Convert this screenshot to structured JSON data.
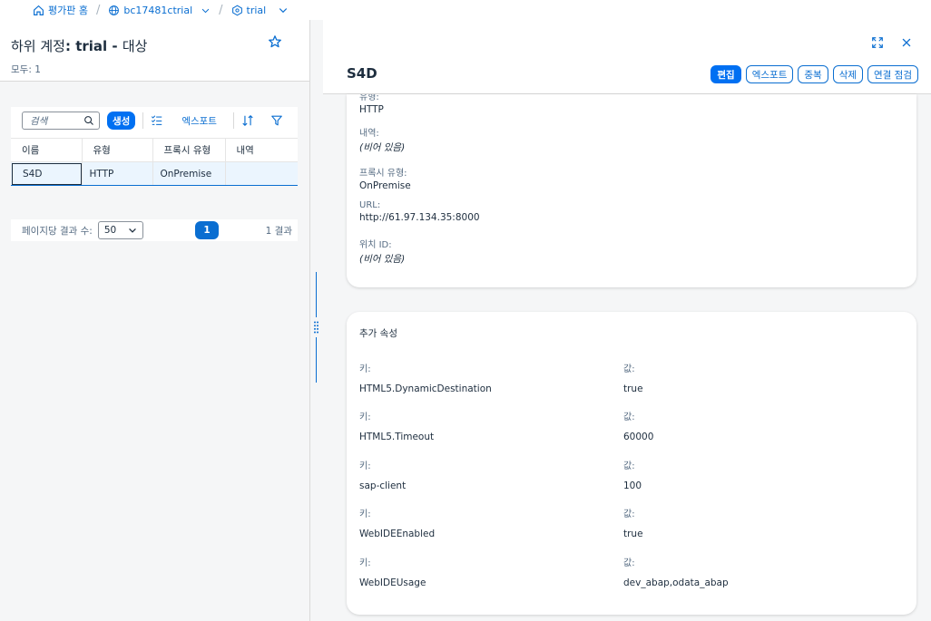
{
  "breadcrumb": {
    "home": "평가판 홈",
    "subaccount": "bc17481ctrial",
    "space": "trial"
  },
  "left": {
    "title_prefix": "하위 계정",
    "title_colon": ":",
    "title_bold": "trial",
    "title_dash": " - ",
    "title_suffix": "대상",
    "subtitle": "모두: 1",
    "search_placeholder": "검색",
    "create_button": "생성",
    "export_button": "엑스포트",
    "columns": [
      "이름",
      "유형",
      "프록시 유형",
      "내역"
    ],
    "rows": [
      {
        "name": "S4D",
        "type": "HTTP",
        "proxy": "OnPremise",
        "desc": ""
      }
    ],
    "per_page_label": "페이지당 결과 수:",
    "per_page_value": "50",
    "current_page": "1",
    "results_count": "1 결과"
  },
  "right": {
    "title": "S4D",
    "actions": {
      "edit": "편집",
      "export": "엑스포트",
      "duplicate": "중복",
      "delete": "삭제",
      "check": "연결 점검"
    },
    "fields": [
      {
        "label": "유형:",
        "value": "HTTP",
        "empty": false
      },
      {
        "label": "내역:",
        "value": "(비어 있음)",
        "empty": true
      },
      {
        "label": "프록시 유형:",
        "value": "OnPremise",
        "empty": false
      },
      {
        "label": "URL:",
        "value": "http://61.97.134.35:8000",
        "empty": false
      },
      {
        "label": "위치 ID:",
        "value": "(비어 있음)",
        "empty": true
      }
    ],
    "additional_title": "추가 속성",
    "key_label": "키:",
    "value_label": "값:",
    "properties": [
      {
        "key": "HTML5.DynamicDestination",
        "value": "true"
      },
      {
        "key": "HTML5.Timeout",
        "value": "60000"
      },
      {
        "key": "sap-client",
        "value": "100"
      },
      {
        "key": "WebIDEEnabled",
        "value": "true"
      },
      {
        "key": "WebIDEUsage",
        "value": "dev_abap,odata_abap"
      }
    ]
  },
  "colors": {
    "accent": "#0a6ed1",
    "primary_button": "#0070f2",
    "selected_row": "#ebf5fe",
    "text": "#1d2d3e",
    "muted_text": "#556b82"
  }
}
